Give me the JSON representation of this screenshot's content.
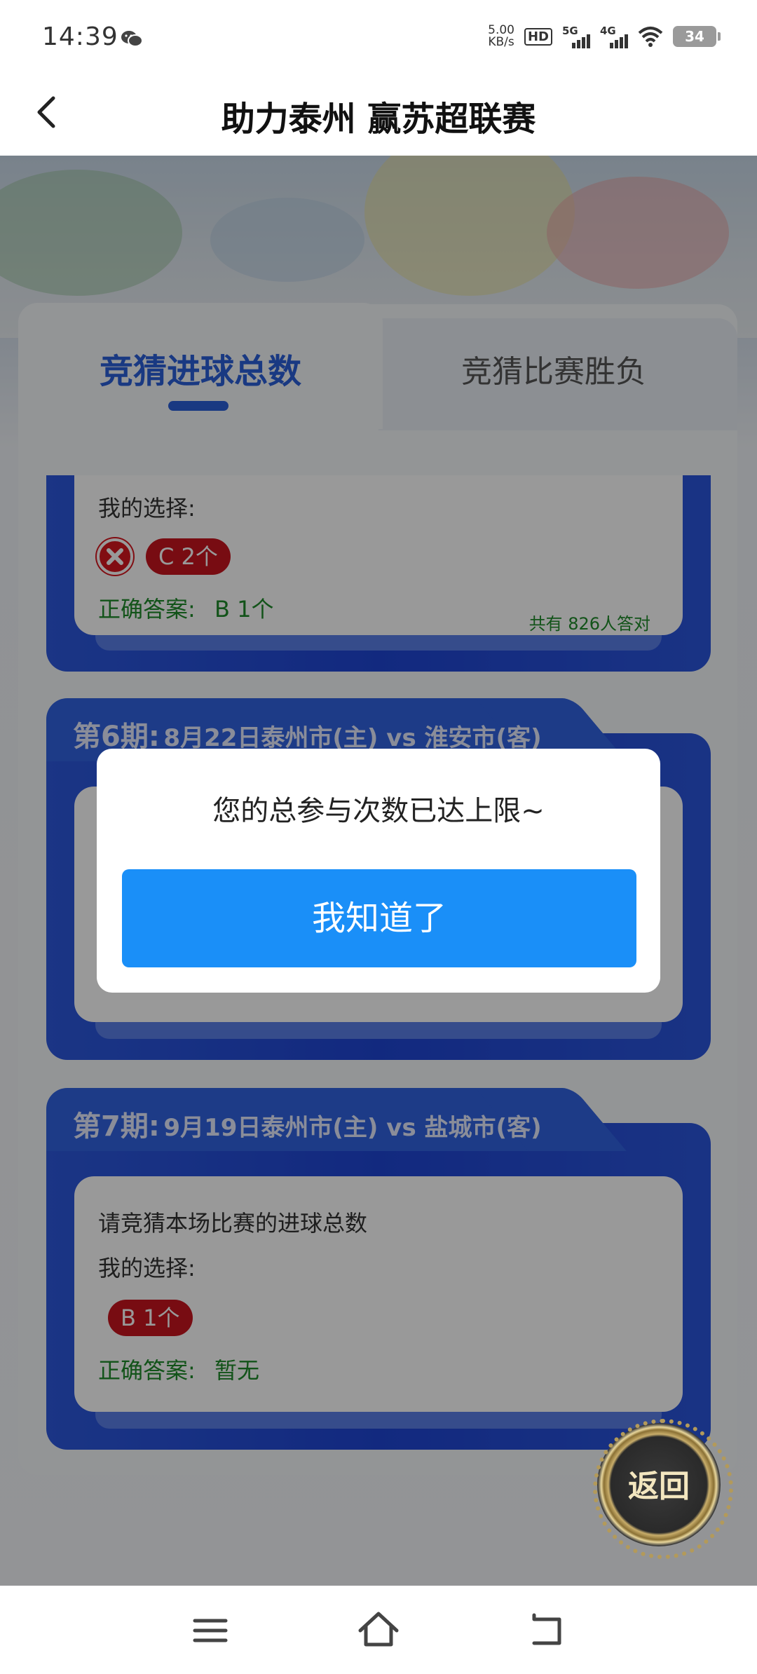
{
  "status_bar": {
    "time": "14:39",
    "speed_value": "5.00",
    "speed_unit": "KB/s",
    "hd_label": "HD",
    "net1": "5G",
    "net2": "4G",
    "battery": "34"
  },
  "header": {
    "title": "助力泰州 赢苏超联赛"
  },
  "tabs": [
    {
      "label": "竞猜进球总数",
      "active": true
    },
    {
      "label": "竞猜比赛胜负",
      "active": false
    }
  ],
  "cards": [
    {
      "my_choice_label": "我的选择:",
      "choice": "C 2个",
      "answer_label": "正确答案:",
      "answer_value": "B 1个",
      "count_text": "共有 826人答对"
    },
    {
      "period_no": "第6期:",
      "period_desc": "8月22日泰州市(主) vs 淮安市(客)"
    },
    {
      "period_no": "第7期:",
      "period_desc": "9月19日泰州市(主) vs 盐城市(客)",
      "question": "请竞猜本场比赛的进球总数",
      "my_choice_label": "我的选择:",
      "choice": "B 1个",
      "answer_label": "正确答案:",
      "answer_value": "暂无"
    }
  ],
  "floating_back": "返回",
  "modal": {
    "message": "您的总参与次数已达上限~",
    "button": "我知道了"
  },
  "colors": {
    "accent_blue": "#2b5fd9",
    "card_blue": "#2d59de",
    "wrong_red": "#d7161f",
    "answer_green": "#1f8a2a",
    "modal_button": "#1a8ff8"
  },
  "icons": [
    "wechat-icon",
    "wifi-icon",
    "back-arrow-icon",
    "wrong-icon",
    "menu-icon",
    "home-icon",
    "back-nav-icon"
  ]
}
